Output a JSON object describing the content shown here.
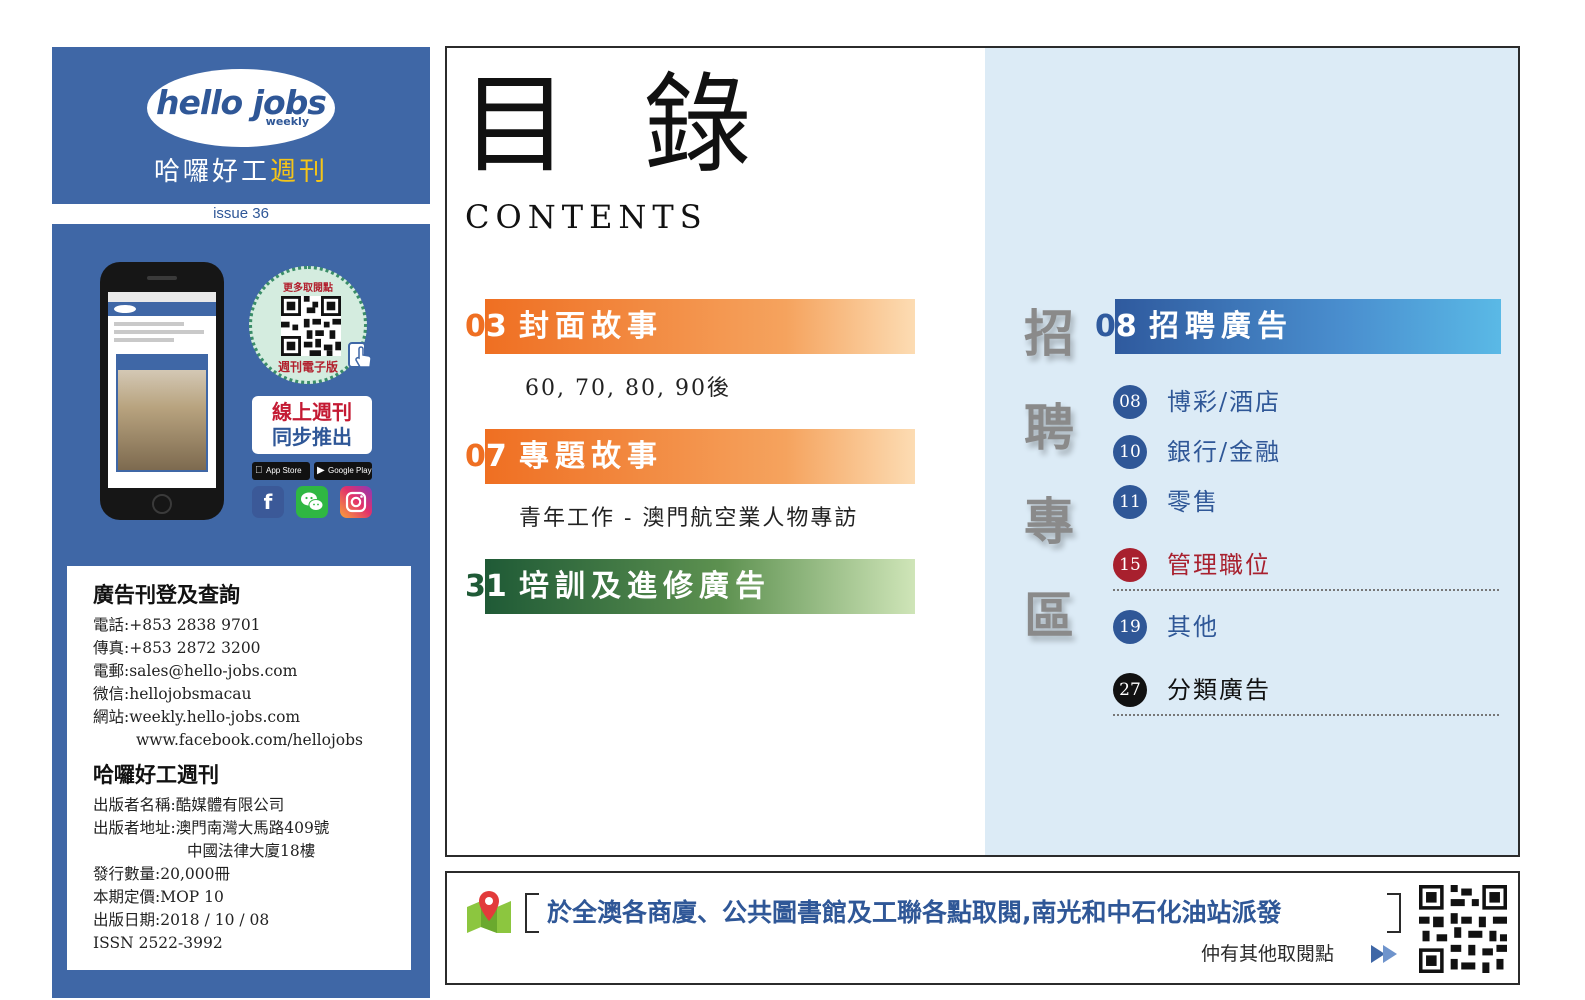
{
  "sidebar": {
    "logo": {
      "word": "hello jobs",
      "sub": "weekly"
    },
    "brand_name": {
      "main": "哈囉好工",
      "accent": "週刊"
    },
    "issue": "issue 36",
    "qr_badge": {
      "top": "更多取閱點",
      "bottom": "週刊電子版"
    },
    "online": {
      "line1": "線上週刊",
      "line2": "同步推出"
    },
    "stores": {
      "apple": "App Store",
      "google": "Google Play"
    },
    "social_icons": [
      "facebook-icon",
      "wechat-icon",
      "instagram-icon"
    ],
    "ads": {
      "title": "廣告刊登及查詢",
      "lines": [
        "電話:+853 2838 9701",
        "傳真:+853 2872 3200",
        "電郵:sales@hello-jobs.com",
        "微信:hellojobsmacau",
        "網站:weekly.hello-jobs.com"
      ],
      "facebook": "www.facebook.com/hellojobs"
    },
    "publisher": {
      "title": "哈囉好工週刊",
      "name": "出版者名稱:酷媒體有限公司",
      "address": "出版者地址:澳門南灣大馬路409號",
      "address2": "中國法律大廈18樓",
      "circulation": "發行數量:20,000冊",
      "price": "本期定價:MOP 10",
      "date": "出版日期:2018 / 10 / 08",
      "issn": "ISSN 2522-3992"
    }
  },
  "contents": {
    "title": "目 錄",
    "subtitle": "CONTENTS",
    "sections": [
      {
        "num_a": "0",
        "num_b": "3",
        "label": "封面故事",
        "desc": "60, 70, 80, 90後"
      },
      {
        "num_a": "0",
        "num_b": "7",
        "label": "專題故事",
        "desc": "青年工作 - 澳門航空業人物專訪"
      },
      {
        "num_a": "3",
        "num_b": "1",
        "label": "培訓及進修廣告"
      }
    ],
    "recruit": {
      "vertical_title": [
        "招",
        "聘",
        "專",
        "區"
      ],
      "num_a": "0",
      "num_b": "8",
      "label": "招聘廣告",
      "categories": [
        {
          "page": "08",
          "label": "博彩/酒店",
          "color": "#2f5797"
        },
        {
          "page": "10",
          "label": "銀行/金融",
          "color": "#2f5797"
        },
        {
          "page": "11",
          "label": "零售",
          "color": "#2f5797"
        },
        {
          "page": "15",
          "label": "管理職位",
          "color": "#a8202e"
        },
        {
          "page": "19",
          "label": "其他",
          "color": "#2f5797"
        },
        {
          "page": "27",
          "label": "分類廣告",
          "color": "#111111"
        }
      ]
    }
  },
  "banner": {
    "text": "於全澳各商廈、公共圖書館及工聯各點取閱,南光和中石化油站派發",
    "more": "仲有其他取閱點"
  },
  "colors": {
    "brand_blue": "#3f67a6",
    "orange": "#ef6f22",
    "green": "#1f5a36",
    "light_blue_panel": "#dcebf6",
    "accent_yellow": "#f5c518",
    "red": "#c41a33"
  }
}
